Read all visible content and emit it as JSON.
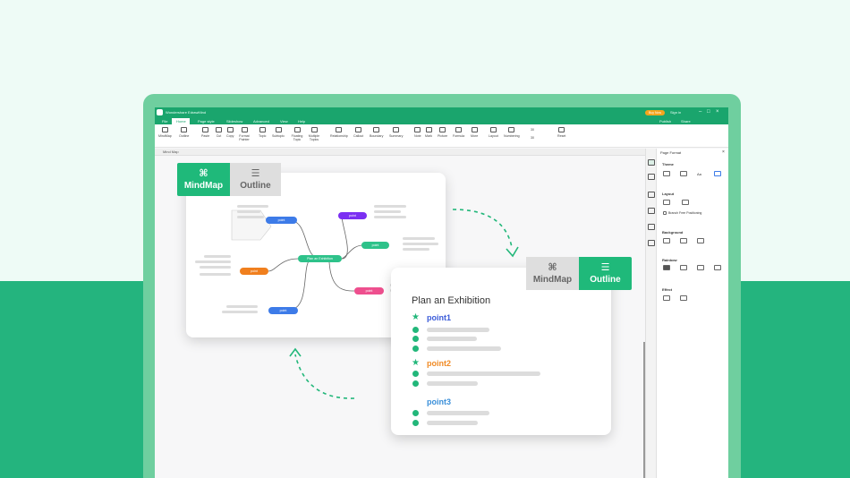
{
  "app": {
    "title": "Wondershare EdrawMind",
    "signin": "Sign in",
    "buy": "Buy Now",
    "publish": "Publish",
    "share": "Share"
  },
  "menu_tabs": [
    "File",
    "Home",
    "Page style",
    "Slideshow",
    "Advanced",
    "View",
    "Help"
  ],
  "ribbon": {
    "items": [
      "MindMap",
      "Outline",
      "Paste",
      "Cut",
      "Copy",
      "Format Painter",
      "Topic",
      "Subtopic",
      "Floating Topic",
      "Multiple Topics",
      "Relationship",
      "Callout",
      "Boundary",
      "Summary",
      "Note",
      "Mark",
      "Picture",
      "Formula",
      "More",
      "Layout",
      "Numbering",
      "30",
      "30",
      "Reset"
    ]
  },
  "doc_tab": "Mind Map",
  "panel": {
    "title": "Page Format",
    "theme": "Theme",
    "layout": "Layout",
    "branch_free": "Branch Free Positioning",
    "background": "Background",
    "rainbow": "Rainbow",
    "effect": "Effect",
    "aa": "Aa"
  },
  "mindmap_card": {
    "tab_mindmap": "MindMap",
    "tab_outline": "Outline",
    "center": "Plan an Exhibition",
    "nodes": [
      "point",
      "point",
      "point",
      "point",
      "point",
      "point"
    ]
  },
  "outline_card": {
    "tab_mindmap": "MindMap",
    "tab_outline": "Outline",
    "title": "Plan an Exhibition",
    "points": [
      "point1",
      "point2",
      "point3"
    ]
  },
  "colors": {
    "brand_green": "#1fb97a",
    "point1": "#3a5bd9",
    "point2": "#f08a24",
    "point3": "#3a8fd9",
    "node_blue": "#3d7be8",
    "node_purple": "#7b2ff2",
    "node_green": "#2ec28a",
    "node_orange": "#f07f1e",
    "node_pink": "#ee4f8e"
  }
}
